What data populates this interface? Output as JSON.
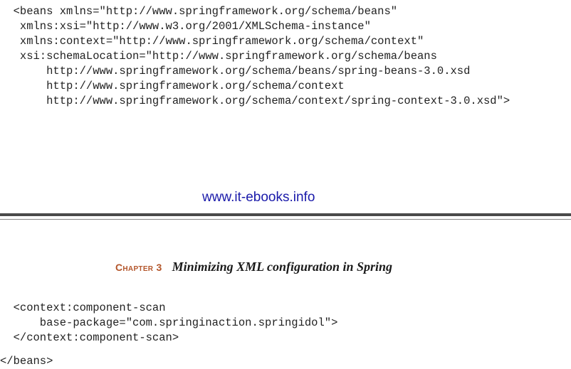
{
  "code_top": {
    "lines": [
      "  <beans xmlns=\"http://www.springframework.org/schema/beans\"",
      "   xmlns:xsi=\"http://www.w3.org/2001/XMLSchema-instance\"",
      "   xmlns:context=\"http://www.springframework.org/schema/context\"",
      "   xsi:schemaLocation=\"http://www.springframework.org/schema/beans",
      "       http://www.springframework.org/schema/beans/spring-beans-3.0.xsd",
      "       http://www.springframework.org/schema/context",
      "       http://www.springframework.org/schema/context/spring-context-3.0.xsd\">"
    ]
  },
  "footer": {
    "link_text": "www.it-ebooks.info"
  },
  "running_head": {
    "chapter_label": "Chapter 3",
    "chapter_title": "Minimizing XML configuration in Spring"
  },
  "code_bottom": {
    "lines": [
      "  <context:component-scan",
      "      base-package=\"com.springinaction.springidol\">",
      "  </context:component-scan>"
    ],
    "closing": "</beans>"
  }
}
